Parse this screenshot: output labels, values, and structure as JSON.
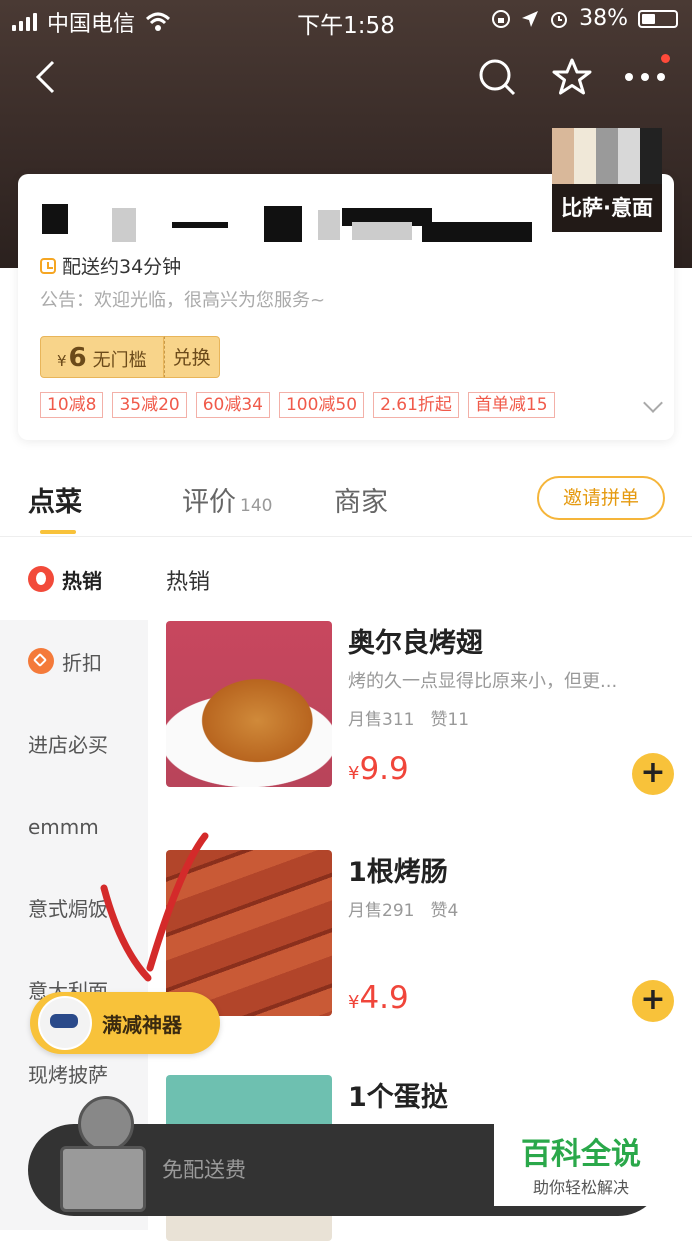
{
  "status_bar": {
    "carrier": "中国电信",
    "time": "下午1:58",
    "battery": "38%"
  },
  "shop": {
    "thumb_caption": "比萨·意面",
    "delivery_time": "配送约34分钟",
    "notice": "公告：欢迎光临，很高兴为您服务~",
    "coupon": {
      "currency": "¥",
      "amount": "6",
      "label": "无门槛",
      "exchange": "兑换"
    },
    "promo_tags": [
      "10减8",
      "35减20",
      "60减34",
      "100减50",
      "2.61折起",
      "首单减15"
    ]
  },
  "tabs": {
    "order": "点菜",
    "reviews": "评价",
    "reviews_count": "140",
    "merchant": "商家",
    "invite": "邀请拼单"
  },
  "sidebar": {
    "items": [
      "热销",
      "折扣",
      "进店必买",
      "emmm",
      "意式焗饭",
      "意大利面",
      "现烤披萨"
    ]
  },
  "menu": {
    "section_title": "热销",
    "items": [
      {
        "name": "奥尔良烤翅",
        "desc": "烤的久一点显得比原来小，但更...",
        "monthly_sales": "月售311",
        "likes": "赞11",
        "currency": "¥",
        "price": "9.9"
      },
      {
        "name": "1根烤肠",
        "desc": "",
        "monthly_sales": "月售291",
        "likes": "赞4",
        "currency": "¥",
        "price": "4.9"
      },
      {
        "name": "1个蛋挞",
        "desc": "",
        "monthly_sales": "",
        "likes": "",
        "currency": "",
        "price": ""
      }
    ]
  },
  "floating": {
    "promo_tool": "满减神器"
  },
  "cart": {
    "free_delivery": "免配送费"
  },
  "watermark": {
    "line1": "百科全说",
    "line2": "助你轻松解决"
  },
  "colors": {
    "accent": "#f8c23a",
    "price": "#f0453a",
    "tag": "#f05a4a"
  }
}
